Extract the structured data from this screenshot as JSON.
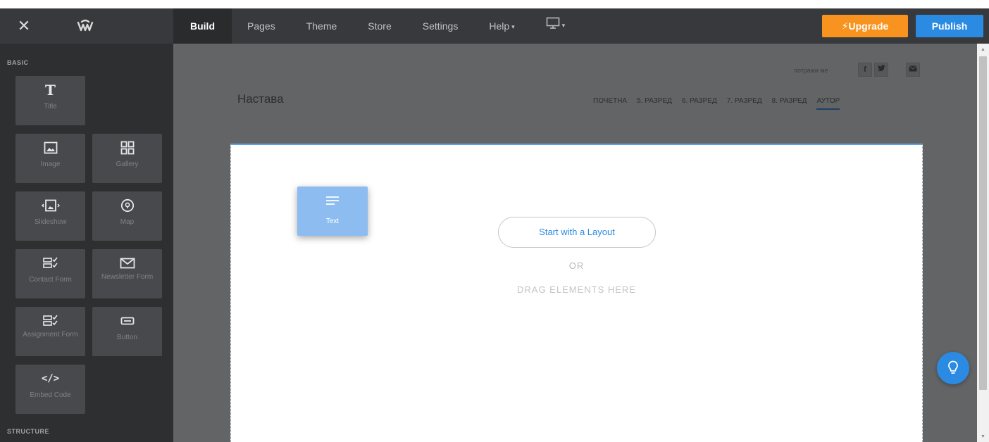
{
  "topbar": {
    "nav": [
      {
        "label": "Build",
        "active": true
      },
      {
        "label": "Pages"
      },
      {
        "label": "Theme"
      },
      {
        "label": "Store"
      },
      {
        "label": "Settings"
      },
      {
        "label": "Help",
        "caret": "▾"
      }
    ],
    "device_caret": "▾",
    "upgrade_label": "Upgrade",
    "publish_label": "Publish",
    "colors": {
      "bar": "#38393c",
      "upgrade": "#f7931e",
      "publish": "#2b8be2"
    }
  },
  "sidebar": {
    "basic_label": "BASIC",
    "structure_label": "STRUCTURE",
    "tiles": [
      {
        "label": "Title",
        "icon": "title-icon"
      },
      {
        "label": "Image",
        "icon": "image-icon"
      },
      {
        "label": "Gallery",
        "icon": "gallery-icon"
      },
      {
        "label": "Slideshow",
        "icon": "slideshow-icon"
      },
      {
        "label": "Map",
        "icon": "map-icon"
      },
      {
        "label": "Contact Form",
        "icon": "contact-form-icon"
      },
      {
        "label": "Newsletter Form",
        "icon": "envelope-icon"
      },
      {
        "label": "Assignment Form",
        "icon": "assignment-form-icon"
      },
      {
        "label": "Button",
        "icon": "button-icon"
      },
      {
        "label": "Embed Code",
        "icon": "code-icon"
      }
    ]
  },
  "site": {
    "title": "Настава",
    "social_label": "потражи ме",
    "social": [
      {
        "label": "f",
        "icon": "facebook-icon"
      },
      {
        "label": "🐦",
        "icon": "twitter-icon"
      },
      {
        "label": "✉",
        "icon": "mail-icon"
      }
    ],
    "nav": [
      "ПОЧЕТНА",
      "5. РАЗРЕД",
      "6. РАЗРЕД",
      "7. РАЗРЕД",
      "8. РАЗРЕД",
      "АУТОР"
    ],
    "active_nav": "АУТОР"
  },
  "dropzone": {
    "layout_button": "Start with a Layout",
    "or_text": "OR",
    "drag_text": "DRAG ELEMENTS HERE"
  },
  "dragging": {
    "label": "Text",
    "icon": "text-lines-icon"
  }
}
